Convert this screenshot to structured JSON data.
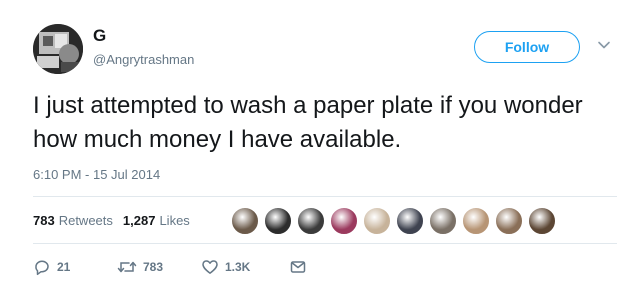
{
  "author": {
    "display_name": "G",
    "handle": "@Angrytrashman"
  },
  "follow_label": "Follow",
  "tweet": {
    "text": "I just attempted to wash a paper plate if you wonder how much money I have available.",
    "timestamp": "6:10 PM - 15 Jul 2014"
  },
  "stats": {
    "retweets_count": "783",
    "retweets_label": "Retweets",
    "likes_count": "1,287",
    "likes_label": "Likes"
  },
  "likers": [
    {
      "color": "#6b5a4a"
    },
    {
      "color": "#2d2d2d"
    },
    {
      "color": "#3b3b3b"
    },
    {
      "color": "#9b3a5e"
    },
    {
      "color": "#c7b39a"
    },
    {
      "color": "#3f4350"
    },
    {
      "color": "#7a7066"
    },
    {
      "color": "#b79575"
    },
    {
      "color": "#8a6f58"
    },
    {
      "color": "#5c4634"
    }
  ],
  "actions": {
    "reply_count": "21",
    "retweet_count": "783",
    "like_count": "1.3K"
  },
  "colors": {
    "accent": "#1da1f2",
    "secondary_text": "#657786",
    "primary_text": "#14171a"
  }
}
